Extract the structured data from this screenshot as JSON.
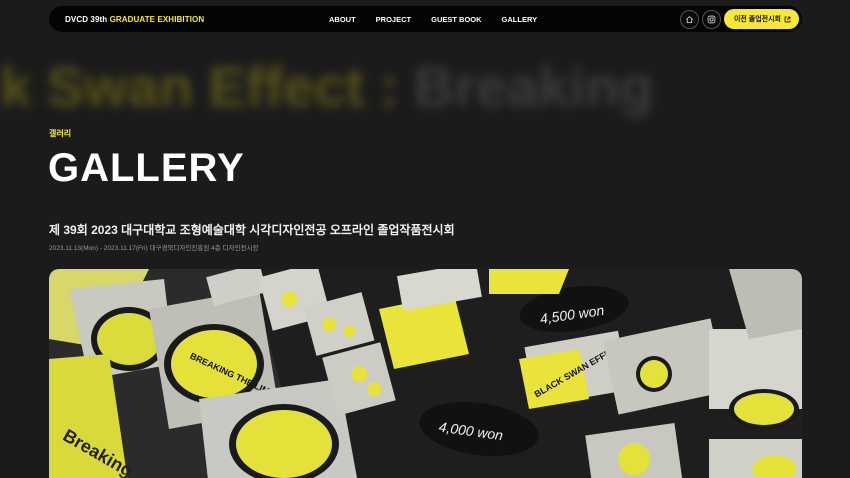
{
  "nav": {
    "brand_prefix": "DVCD 39th",
    "brand_highlight": "GRADUATE EXHIBITION",
    "menu": [
      "ABOUT",
      "PROJECT",
      "GUEST BOOK",
      "GALLERY"
    ],
    "prev_exhibition_label": "이전 졸업전시회",
    "icons": [
      "home-icon",
      "instagram-icon",
      "external-link-icon"
    ]
  },
  "marquee": {
    "text_highlight": "k Swan Effect : ",
    "text_rest": "Breaking"
  },
  "page": {
    "eyebrow": "갤러리",
    "title": "GALLERY",
    "subtitle": "제 39회 2023 대구대학교 조형예술대학 시각디자인전공 오프라인 졸업작품전시회",
    "meta": "2023.11.13(Mon) - 2023.11.17(Fri) 대구경북디자인진흥원 4층 디자인전시장"
  },
  "photo": {
    "tags": [
      "4,500 won",
      "4,000 won"
    ],
    "sticker_text": [
      "BREAKING THE LIMITS",
      "BLACK SWAN EFFECT",
      "Breaking"
    ]
  },
  "colors": {
    "accent": "#f5e83a",
    "background": "#1b1b1b",
    "nav_bg": "#050505"
  }
}
